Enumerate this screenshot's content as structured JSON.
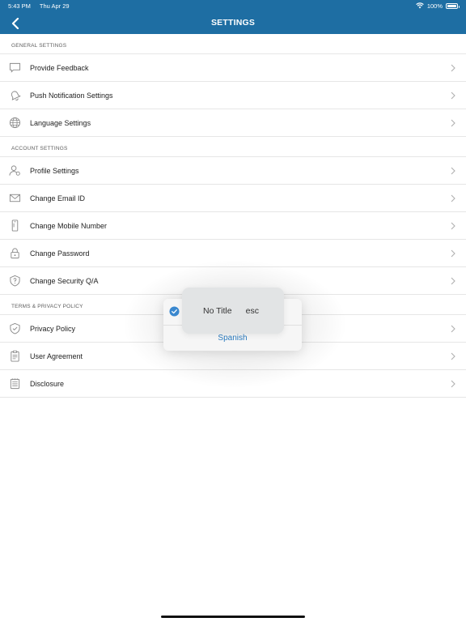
{
  "status_bar": {
    "time": "5:43 PM",
    "date": "Thu Apr 29",
    "battery": "100%",
    "battery_level": 1.0
  },
  "nav": {
    "title": "SETTINGS",
    "back_icon": "chevron-left-icon"
  },
  "sections": [
    {
      "header": "GENERAL SETTINGS",
      "items": [
        {
          "label": "Provide Feedback",
          "icon": "speech-bubble-icon"
        },
        {
          "label": "Push Notification Settings",
          "icon": "bell-icon"
        },
        {
          "label": "Language Settings",
          "icon": "globe-icon"
        }
      ]
    },
    {
      "header": "ACCOUNT SETTINGS",
      "items": [
        {
          "label": "Profile Settings",
          "icon": "user-gear-icon"
        },
        {
          "label": "Change Email ID",
          "icon": "envelope-icon"
        },
        {
          "label": "Change Mobile Number",
          "icon": "mobile-phone-icon"
        },
        {
          "label": "Change Password",
          "icon": "lock-icon"
        },
        {
          "label": "Change Security Q/A",
          "icon": "shield-question-icon"
        }
      ]
    },
    {
      "header": "TERMS & PRIVACY POLICY",
      "items": [
        {
          "label": "Privacy Policy",
          "icon": "shield-check-icon"
        },
        {
          "label": "User Agreement",
          "icon": "clipboard-icon"
        },
        {
          "label": "Disclosure",
          "icon": "document-list-icon"
        }
      ]
    }
  ],
  "language_menu": {
    "options": [
      "Spanish"
    ],
    "selected_icon": "checkmark-circle-icon",
    "check_color": "#3a88cf",
    "option_color": "#2a7bbf"
  },
  "tooltip": {
    "title": "No Title",
    "key": "esc"
  },
  "colors": {
    "header_bg": "#1e6ea3",
    "divider": "#e6e6e6",
    "icon_gray": "#8a8a8a"
  }
}
